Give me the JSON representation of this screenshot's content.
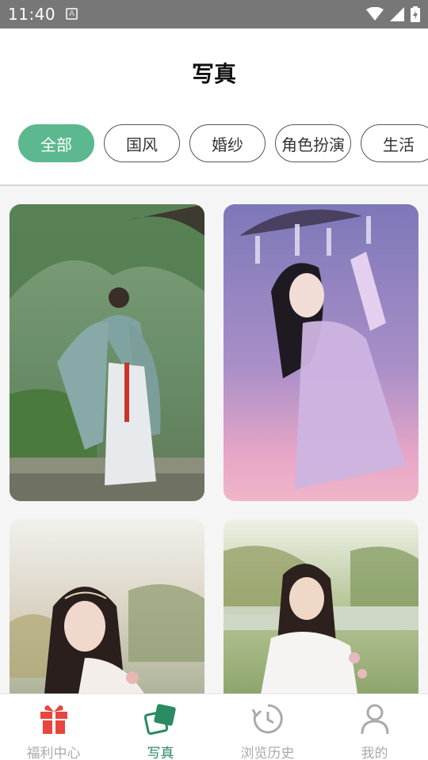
{
  "status_bar": {
    "time": "11:40",
    "notification_letter": "A"
  },
  "header": {
    "title": "写真"
  },
  "tabs": [
    {
      "label": "全部",
      "active": true
    },
    {
      "label": "国风",
      "active": false
    },
    {
      "label": "婚纱",
      "active": false
    },
    {
      "label": "角色扮演",
      "active": false
    },
    {
      "label": "生活",
      "active": false
    }
  ],
  "photos": [
    {
      "subject": "hanfu-woman-garden-willow"
    },
    {
      "subject": "hanfu-woman-umbrella-purple-sky"
    },
    {
      "subject": "woman-headpiece-lakeside"
    },
    {
      "subject": "woman-white-dress-field"
    }
  ],
  "bottom_nav": [
    {
      "label": "福利中心",
      "icon": "gift-icon",
      "active": false
    },
    {
      "label": "写真",
      "icon": "photo-stack-icon",
      "active": true
    },
    {
      "label": "浏览历史",
      "icon": "history-clock-icon",
      "active": false
    },
    {
      "label": "我的",
      "icon": "user-icon",
      "active": false
    }
  ],
  "colors": {
    "accent": "#5cb88e",
    "nav_active": "#2a8a62",
    "gift_red": "#e8463e",
    "status_bar": "#777777"
  }
}
